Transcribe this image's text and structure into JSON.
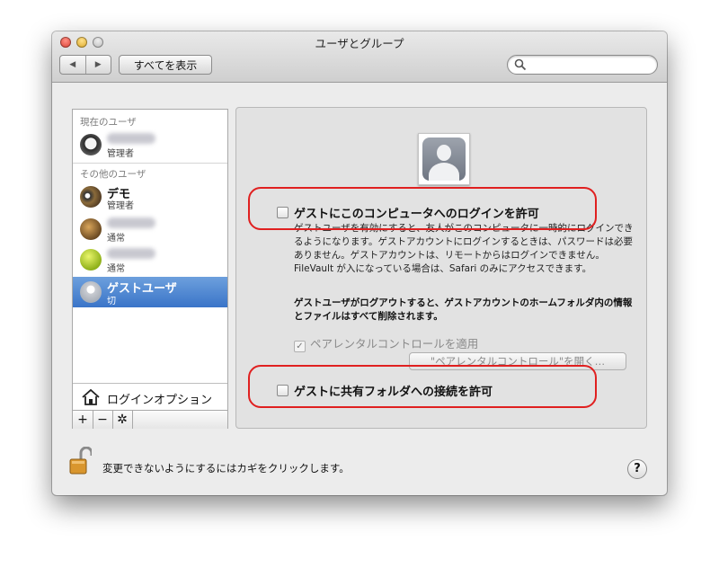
{
  "window": {
    "title": "ユーザとグループ"
  },
  "toolbar": {
    "back_label": "◀",
    "forward_label": "▶",
    "show_all_label": "すべてを表示",
    "search_placeholder": ""
  },
  "sidebar": {
    "current_header": "現在のユーザ",
    "others_header": "その他のユーザ",
    "current_user": {
      "role": "管理者"
    },
    "users": [
      {
        "name": "デモ",
        "role": "管理者"
      },
      {
        "name": "",
        "role": "通常"
      },
      {
        "name": "",
        "role": "通常"
      },
      {
        "name": "ゲストユーザ",
        "role": "切",
        "selected": true
      }
    ],
    "login_options": "ログインオプション",
    "add_label": "+",
    "remove_label": "−",
    "action_label": "✲"
  },
  "guest": {
    "allow_login_label": "ゲストにこのコンピュータへのログインを許可",
    "description": "ゲストユーザを有効にすると、友人がこのコンピュータに一時的にログインできるようになります。ゲストアカウントにログインするときは、パスワードは必要ありません。ゲストアカウントは、リモートからはログインできません。FileVault が入になっている場合は、Safari のみにアクセスできます。",
    "logout_note": "ゲストユーザがログアウトすると、ゲストアカウントのホームフォルダ内の情報とファイルはすべて削除されます。",
    "parental_check_label": "ペアレンタルコントロールを適用",
    "parental_button_label": "\"ペアレンタルコントロール\"を開く…",
    "allow_shared_label": "ゲストに共有フォルダへの接続を許可"
  },
  "footer": {
    "lock_text": "変更できないようにするにはカギをクリックします。",
    "help_label": "?"
  }
}
